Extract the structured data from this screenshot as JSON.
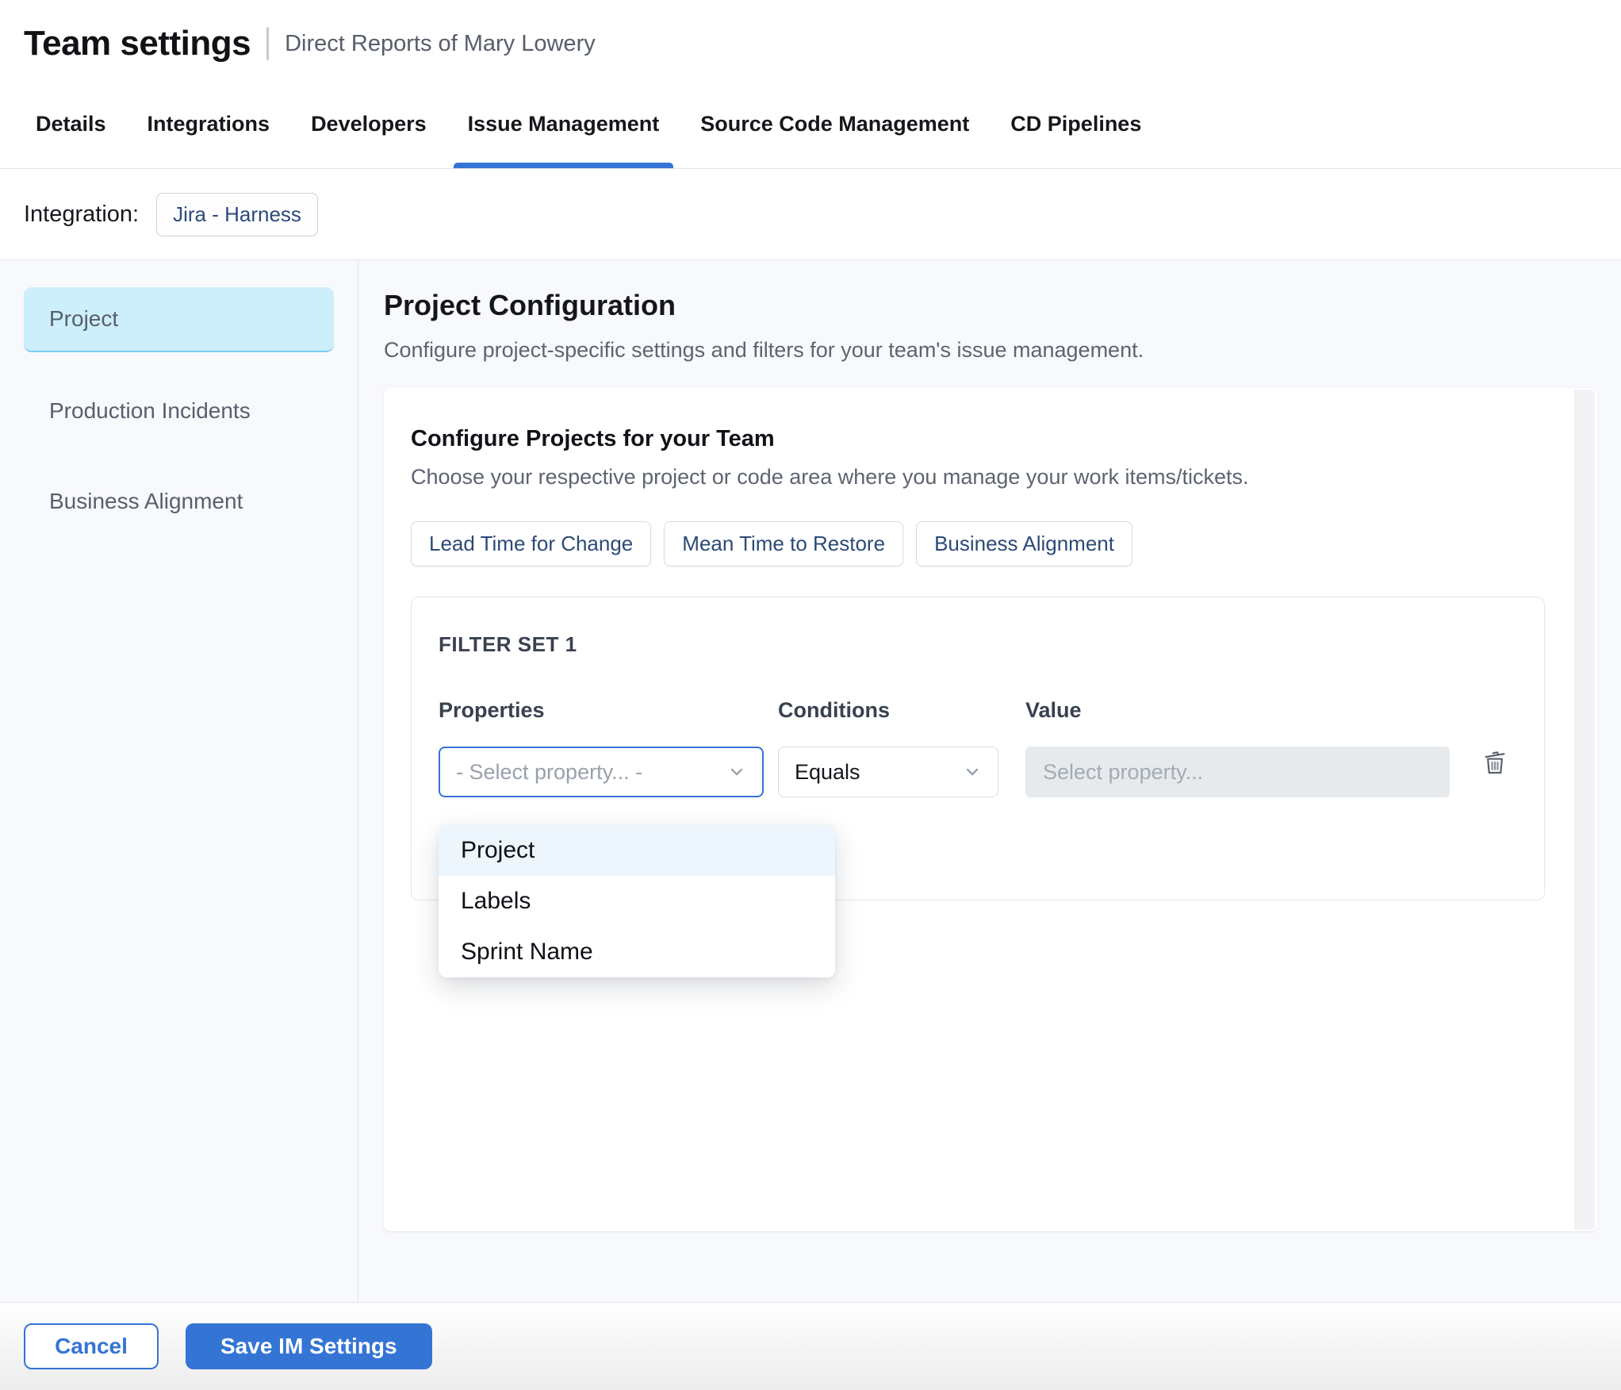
{
  "header": {
    "title": "Team settings",
    "subtitle": "Direct Reports of Mary Lowery"
  },
  "tabs": [
    {
      "label": "Details",
      "active": false
    },
    {
      "label": "Integrations",
      "active": false
    },
    {
      "label": "Developers",
      "active": false
    },
    {
      "label": "Issue Management",
      "active": true
    },
    {
      "label": "Source Code Management",
      "active": false
    },
    {
      "label": "CD Pipelines",
      "active": false
    }
  ],
  "integration": {
    "label": "Integration:",
    "chip": "Jira - Harness"
  },
  "sidebar": {
    "items": [
      {
        "label": "Project",
        "active": true
      },
      {
        "label": "Production Incidents",
        "active": false
      },
      {
        "label": "Business Alignment",
        "active": false
      }
    ]
  },
  "main": {
    "title": "Project Configuration",
    "description": "Configure project-specific settings and filters for your team's issue management.",
    "card": {
      "title": "Configure Projects for your Team",
      "description": "Choose your respective project or code area where you manage your work items/tickets.",
      "chips": [
        {
          "label": "Lead Time for Change"
        },
        {
          "label": "Mean Time to Restore"
        },
        {
          "label": "Business Alignment"
        }
      ],
      "filter_set": {
        "title": "FILTER SET 1",
        "columns": {
          "properties": "Properties",
          "conditions": "Conditions",
          "value": "Value"
        },
        "property_placeholder": "- Select property... -",
        "condition_value": "Equals",
        "value_placeholder": "Select property...",
        "dropdown_options": [
          {
            "label": "Project",
            "highlighted": true
          },
          {
            "label": "Labels",
            "highlighted": false
          },
          {
            "label": "Sprint Name",
            "highlighted": false
          }
        ]
      }
    }
  },
  "footer": {
    "cancel_label": "Cancel",
    "save_label": "Save IM Settings"
  },
  "icons": {
    "chevron_down": "chevron-down-icon",
    "trash": "trash-icon"
  },
  "colors": {
    "accent_blue": "#3474d4",
    "sidebar_selected_bg": "#cdeffb",
    "sidebar_selected_border": "#79d0ee",
    "chip_text_navy": "#2c4a78",
    "page_background": "#f8f9fc",
    "dropdown_highlight": "#ecf6fc",
    "value_input_bg": "#e7eaec",
    "muted_text": "#5d6470"
  }
}
